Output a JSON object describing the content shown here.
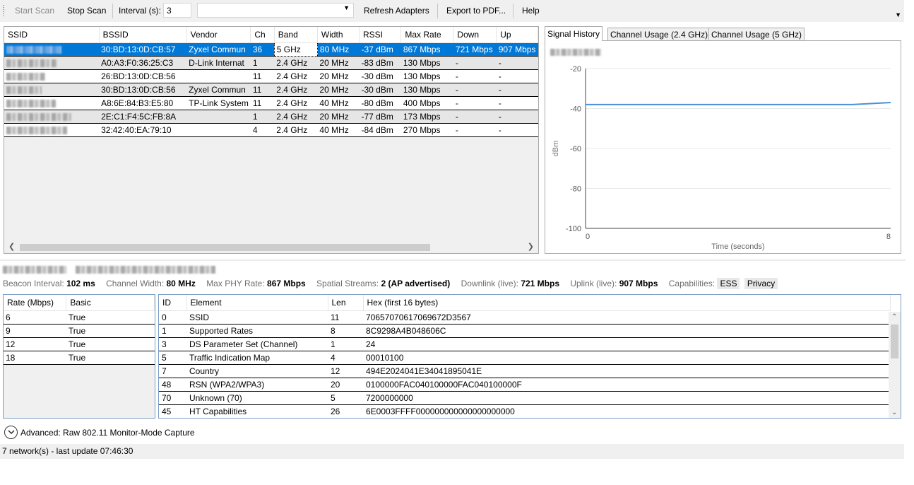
{
  "toolbar": {
    "start_scan": "Start Scan",
    "stop_scan": "Stop Scan",
    "interval_label": "Interval (s):",
    "interval_value": "3",
    "adapter_value": "",
    "refresh_adapters": "Refresh Adapters",
    "export_pdf": "Export to PDF...",
    "help": "Help"
  },
  "networks": {
    "columns": [
      "SSID",
      "BSSID",
      "Vendor",
      "Ch",
      "Band",
      "Width",
      "RSSI",
      "Max Rate",
      "Down",
      "Up"
    ],
    "rows": [
      {
        "ssid": "",
        "bssid": "30:BD:13:0D:CB:57",
        "vendor": "Zyxel Commun",
        "ch": "36",
        "band": "5 GHz",
        "width": "80 MHz",
        "rssi": "-37 dBm",
        "max_rate": "867 Mbps",
        "down": "721 Mbps",
        "up": "907 Mbps",
        "selected": true
      },
      {
        "ssid": "",
        "bssid": "A0:A3:F0:36:25:C3",
        "vendor": "D-Link Internat",
        "ch": "1",
        "band": "2.4 GHz",
        "width": "20 MHz",
        "rssi": "-83 dBm",
        "max_rate": "130 Mbps",
        "down": "-",
        "up": "-"
      },
      {
        "ssid": "",
        "bssid": "26:BD:13:0D:CB:56",
        "vendor": "",
        "ch": "11",
        "band": "2.4 GHz",
        "width": "20 MHz",
        "rssi": "-30 dBm",
        "max_rate": "130 Mbps",
        "down": "-",
        "up": "-"
      },
      {
        "ssid": "",
        "bssid": "30:BD:13:0D:CB:56",
        "vendor": "Zyxel Commun",
        "ch": "11",
        "band": "2.4 GHz",
        "width": "20 MHz",
        "rssi": "-30 dBm",
        "max_rate": "130 Mbps",
        "down": "-",
        "up": "-"
      },
      {
        "ssid": "",
        "bssid": "A8:6E:84:B3:E5:80",
        "vendor": "TP-Link System",
        "ch": "11",
        "band": "2.4 GHz",
        "width": "40 MHz",
        "rssi": "-80 dBm",
        "max_rate": "400 Mbps",
        "down": "-",
        "up": "-"
      },
      {
        "ssid": "",
        "bssid": "2E:C1:F4:5C:FB:8A",
        "vendor": "",
        "ch": "1",
        "band": "2.4 GHz",
        "width": "20 MHz",
        "rssi": "-77 dBm",
        "max_rate": "173 Mbps",
        "down": "-",
        "up": "-"
      },
      {
        "ssid": "",
        "bssid": "32:42:40:EA:79:10",
        "vendor": "",
        "ch": "4",
        "band": "2.4 GHz",
        "width": "40 MHz",
        "rssi": "-84 dBm",
        "max_rate": "270 Mbps",
        "down": "-",
        "up": "-"
      }
    ]
  },
  "tabs": [
    "Signal History",
    "Channel Usage (2.4 GHz)",
    "Channel Usage (5 GHz)"
  ],
  "chart_data": {
    "type": "line",
    "title": "",
    "xlabel": "Time (seconds)",
    "ylabel": "dBm",
    "xlim": [
      0,
      8
    ],
    "ylim": [
      -100,
      -20
    ],
    "xticks": [
      0,
      8
    ],
    "yticks": [
      -20,
      -40,
      -60,
      -80,
      -100
    ],
    "grid": true,
    "series": [
      {
        "x": [
          0,
          1,
          2,
          3,
          4,
          5,
          6,
          7,
          8
        ],
        "values": [
          -38,
          -38,
          -38,
          -38,
          -38,
          -38,
          -38,
          -38,
          -37
        ],
        "color": "#4a90d9"
      }
    ]
  },
  "details": {
    "beacon_interval_label": "Beacon Interval:",
    "beacon_interval": "102 ms",
    "channel_width_label": "Channel Width:",
    "channel_width": "80 MHz",
    "max_phy_label": "Max PHY Rate:",
    "max_phy": "867 Mbps",
    "spatial_label": "Spatial Streams:",
    "spatial": "2 (AP advertised)",
    "downlink_label": "Downlink (live):",
    "downlink": "721 Mbps",
    "uplink_label": "Uplink (live):",
    "uplink": "907 Mbps",
    "capabilities_label": "Capabilities:",
    "capabilities": [
      "ESS",
      "Privacy"
    ]
  },
  "rates": {
    "columns": [
      "Rate (Mbps)",
      "Basic"
    ],
    "rows": [
      {
        "rate": "6",
        "basic": "True"
      },
      {
        "rate": "9",
        "basic": "True"
      },
      {
        "rate": "12",
        "basic": "True"
      },
      {
        "rate": "18",
        "basic": "True"
      }
    ]
  },
  "ies": {
    "columns": [
      "ID",
      "Element",
      "Len",
      "Hex (first 16 bytes)"
    ],
    "rows": [
      {
        "id": "0",
        "element": "SSID",
        "len": "11",
        "hex": "70657070617069672D3567"
      },
      {
        "id": "1",
        "element": "Supported Rates",
        "len": "8",
        "hex": "8C9298A4B048606C"
      },
      {
        "id": "3",
        "element": "DS Parameter Set (Channel)",
        "len": "1",
        "hex": "24"
      },
      {
        "id": "5",
        "element": "Traffic Indication Map",
        "len": "4",
        "hex": "00010100"
      },
      {
        "id": "7",
        "element": "Country",
        "len": "12",
        "hex": "494E2024041E34041895041E"
      },
      {
        "id": "48",
        "element": "RSN (WPA2/WPA3)",
        "len": "20",
        "hex": "0100000FAC040100000FAC040100000F"
      },
      {
        "id": "70",
        "element": "Unknown (70)",
        "len": "5",
        "hex": "7200000000"
      },
      {
        "id": "45",
        "element": "HT Capabilities",
        "len": "26",
        "hex": "6E0003FFFF000000000000000000000"
      }
    ]
  },
  "advanced_label": "Advanced: Raw 802.11 Monitor-Mode Capture",
  "status": "7 network(s) - last update 07:46:30"
}
